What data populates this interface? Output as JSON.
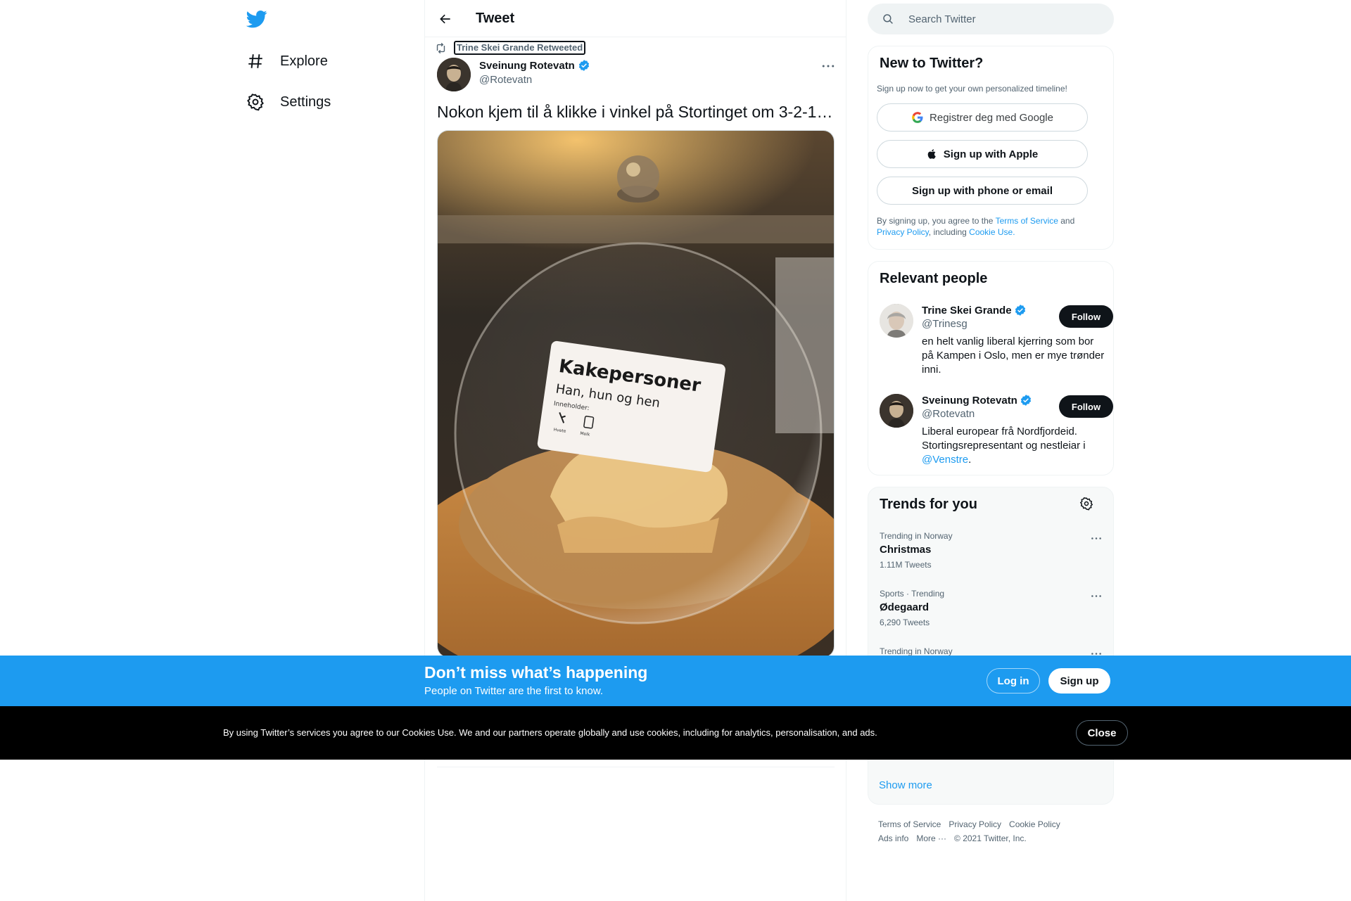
{
  "nav": {
    "items": [
      {
        "label": "Explore",
        "icon": "hashtag-icon"
      },
      {
        "label": "Settings",
        "icon": "gear-icon"
      }
    ]
  },
  "header": {
    "title": "Tweet"
  },
  "tweet": {
    "retweeted_by": "Trine Skei Grande Retweeted",
    "author_name": "Sveinung Rotevatn",
    "author_handle": "@Rotevatn",
    "text": "Nokon kjem til å klikke i vinkel på Stortinget om 3-2-1…",
    "image_label": {
      "title": "Kakepersoner",
      "subtitle": "Han, hun og hen",
      "contains": "Inneholder:",
      "icon1": "Hvete",
      "icon2": "Melk"
    }
  },
  "search": {
    "placeholder": "Search Twitter"
  },
  "signup_card": {
    "title": "New to Twitter?",
    "subtitle": "Sign up now to get your own personalized timeline!",
    "google": "Registrer deg med Google",
    "apple": "Sign up with Apple",
    "phone": "Sign up with phone or email",
    "terms_prefix": "By signing up, you agree to the ",
    "terms_link": "Terms of Service",
    "terms_and": " and ",
    "privacy_link": "Privacy Policy",
    "terms_including": ", including ",
    "cookie_link": "Cookie Use."
  },
  "relevant": {
    "title": "Relevant people",
    "people": [
      {
        "name": "Trine Skei Grande",
        "handle": "@Trinesg",
        "bio": "en helt vanlig liberal kjerring som bor på Kampen i Oslo, men er mye trønder inni.",
        "follow": "Follow"
      },
      {
        "name": "Sveinung Rotevatn",
        "handle": "@Rotevatn",
        "bio": "Liberal europear frå Nordfjordeid. Stortingsrepresentant og nestleiar i ",
        "mention": "@Venstre",
        "bio_end": ".",
        "follow": "Follow"
      }
    ]
  },
  "trends": {
    "title": "Trends for you",
    "items": [
      {
        "meta": "Trending in Norway",
        "name": "Christmas",
        "count": "1.11M Tweets"
      },
      {
        "meta": "Sports · Trending",
        "name": "Ødegaard",
        "count": "6,290 Tweets"
      },
      {
        "meta": "Trending in Norway",
        "name": "",
        "count": ""
      }
    ],
    "show_more": "Show more"
  },
  "footer": {
    "links": [
      "Terms of Service",
      "Privacy Policy",
      "Cookie Policy",
      "Ads info",
      "More ···"
    ],
    "copyright": "© 2021 Twitter, Inc."
  },
  "banner": {
    "title": "Don’t miss what’s happening",
    "subtitle": "People on Twitter are the first to know.",
    "login": "Log in",
    "signup": "Sign up"
  },
  "cookie": {
    "text": "By using Twitter’s services you agree to our Cookies Use. We and our partners operate globally and use cookies, including for analytics, personalisation, and ads.",
    "close": "Close"
  },
  "colors": {
    "accent": "#1d9bf0",
    "text": "#0f1419",
    "muted": "#536471",
    "cookie_bg": "#000000"
  }
}
